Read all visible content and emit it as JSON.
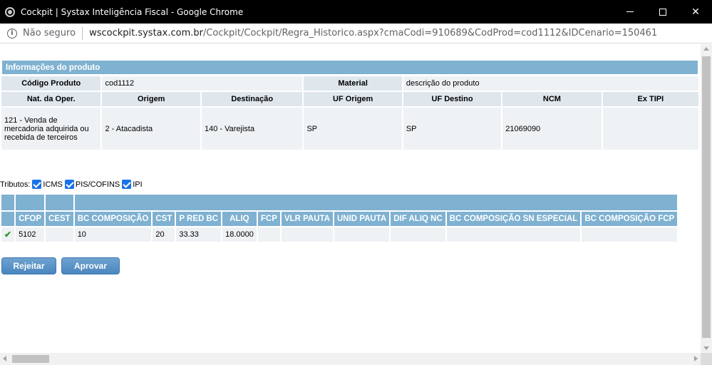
{
  "window": {
    "title": "Cockpit | Systax Inteligência Fiscal - Google Chrome"
  },
  "addressbar": {
    "security_label": "Não seguro",
    "url_host": "wscockpit.systax.com.br",
    "url_path": "/Cockpit/Cockpit/Regra_Historico.aspx?cmaCodi=910689&CodProd=cod1112&IDCenario=150461"
  },
  "product": {
    "section_title": "Informações do produto",
    "codigo_label": "Código Produto",
    "codigo_value": "cod1112",
    "material_label": "Material",
    "material_value": "descrição do produto",
    "headers": [
      "Nat. da Oper.",
      "Origem",
      "Destinação",
      "UF Origem",
      "UF Destino",
      "NCM",
      "Ex TIPI"
    ],
    "values": [
      "121 - Venda de mercadoria adquirida ou recebida de terceiros",
      "2 - Atacadista",
      "140 - Varejista",
      "SP",
      "SP",
      "21069090",
      ""
    ]
  },
  "tributos": {
    "label": "Tributos:",
    "options": [
      {
        "label": "ICMS",
        "checked": true
      },
      {
        "label": "PIS/COFINS",
        "checked": true
      },
      {
        "label": "IPI",
        "checked": true
      }
    ]
  },
  "rules_table": {
    "columns": [
      "",
      "CFOP",
      "CEST",
      "BC COMPOSIÇÃO",
      "CST",
      "P RED BC",
      "ALIQ",
      "FCP",
      "VLR PAUTA",
      "UNID PAUTA",
      "DIF ALIQ NC",
      "BC COMPOSIÇÃO SN ESPECIAL",
      "BC COMPOSIÇÃO FCP"
    ],
    "row": [
      "✔",
      "5102",
      "",
      "10",
      "20",
      "33.33",
      "18.0000",
      "",
      "",
      "",
      "",
      "",
      ""
    ]
  },
  "buttons": {
    "reject": "Rejeitar",
    "approve": "Aprovar"
  },
  "colors": {
    "header_blue": "#7fb1d1",
    "button_blue": "#4a86bf",
    "check_green": "#2a9a2a"
  }
}
